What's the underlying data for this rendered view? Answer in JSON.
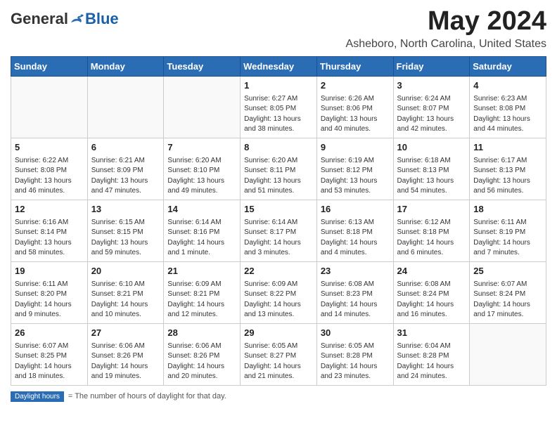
{
  "header": {
    "logo_general": "General",
    "logo_blue": "Blue",
    "month_title": "May 2024",
    "location": "Asheboro, North Carolina, United States"
  },
  "days_of_week": [
    "Sunday",
    "Monday",
    "Tuesday",
    "Wednesday",
    "Thursday",
    "Friday",
    "Saturday"
  ],
  "weeks": [
    [
      {
        "day": "",
        "info": ""
      },
      {
        "day": "",
        "info": ""
      },
      {
        "day": "",
        "info": ""
      },
      {
        "day": "1",
        "info": "Sunrise: 6:27 AM\nSunset: 8:05 PM\nDaylight: 13 hours\nand 38 minutes."
      },
      {
        "day": "2",
        "info": "Sunrise: 6:26 AM\nSunset: 8:06 PM\nDaylight: 13 hours\nand 40 minutes."
      },
      {
        "day": "3",
        "info": "Sunrise: 6:24 AM\nSunset: 8:07 PM\nDaylight: 13 hours\nand 42 minutes."
      },
      {
        "day": "4",
        "info": "Sunrise: 6:23 AM\nSunset: 8:08 PM\nDaylight: 13 hours\nand 44 minutes."
      }
    ],
    [
      {
        "day": "5",
        "info": "Sunrise: 6:22 AM\nSunset: 8:08 PM\nDaylight: 13 hours\nand 46 minutes."
      },
      {
        "day": "6",
        "info": "Sunrise: 6:21 AM\nSunset: 8:09 PM\nDaylight: 13 hours\nand 47 minutes."
      },
      {
        "day": "7",
        "info": "Sunrise: 6:20 AM\nSunset: 8:10 PM\nDaylight: 13 hours\nand 49 minutes."
      },
      {
        "day": "8",
        "info": "Sunrise: 6:20 AM\nSunset: 8:11 PM\nDaylight: 13 hours\nand 51 minutes."
      },
      {
        "day": "9",
        "info": "Sunrise: 6:19 AM\nSunset: 8:12 PM\nDaylight: 13 hours\nand 53 minutes."
      },
      {
        "day": "10",
        "info": "Sunrise: 6:18 AM\nSunset: 8:13 PM\nDaylight: 13 hours\nand 54 minutes."
      },
      {
        "day": "11",
        "info": "Sunrise: 6:17 AM\nSunset: 8:13 PM\nDaylight: 13 hours\nand 56 minutes."
      }
    ],
    [
      {
        "day": "12",
        "info": "Sunrise: 6:16 AM\nSunset: 8:14 PM\nDaylight: 13 hours\nand 58 minutes."
      },
      {
        "day": "13",
        "info": "Sunrise: 6:15 AM\nSunset: 8:15 PM\nDaylight: 13 hours\nand 59 minutes."
      },
      {
        "day": "14",
        "info": "Sunrise: 6:14 AM\nSunset: 8:16 PM\nDaylight: 14 hours\nand 1 minute."
      },
      {
        "day": "15",
        "info": "Sunrise: 6:14 AM\nSunset: 8:17 PM\nDaylight: 14 hours\nand 3 minutes."
      },
      {
        "day": "16",
        "info": "Sunrise: 6:13 AM\nSunset: 8:18 PM\nDaylight: 14 hours\nand 4 minutes."
      },
      {
        "day": "17",
        "info": "Sunrise: 6:12 AM\nSunset: 8:18 PM\nDaylight: 14 hours\nand 6 minutes."
      },
      {
        "day": "18",
        "info": "Sunrise: 6:11 AM\nSunset: 8:19 PM\nDaylight: 14 hours\nand 7 minutes."
      }
    ],
    [
      {
        "day": "19",
        "info": "Sunrise: 6:11 AM\nSunset: 8:20 PM\nDaylight: 14 hours\nand 9 minutes."
      },
      {
        "day": "20",
        "info": "Sunrise: 6:10 AM\nSunset: 8:21 PM\nDaylight: 14 hours\nand 10 minutes."
      },
      {
        "day": "21",
        "info": "Sunrise: 6:09 AM\nSunset: 8:21 PM\nDaylight: 14 hours\nand 12 minutes."
      },
      {
        "day": "22",
        "info": "Sunrise: 6:09 AM\nSunset: 8:22 PM\nDaylight: 14 hours\nand 13 minutes."
      },
      {
        "day": "23",
        "info": "Sunrise: 6:08 AM\nSunset: 8:23 PM\nDaylight: 14 hours\nand 14 minutes."
      },
      {
        "day": "24",
        "info": "Sunrise: 6:08 AM\nSunset: 8:24 PM\nDaylight: 14 hours\nand 16 minutes."
      },
      {
        "day": "25",
        "info": "Sunrise: 6:07 AM\nSunset: 8:24 PM\nDaylight: 14 hours\nand 17 minutes."
      }
    ],
    [
      {
        "day": "26",
        "info": "Sunrise: 6:07 AM\nSunset: 8:25 PM\nDaylight: 14 hours\nand 18 minutes."
      },
      {
        "day": "27",
        "info": "Sunrise: 6:06 AM\nSunset: 8:26 PM\nDaylight: 14 hours\nand 19 minutes."
      },
      {
        "day": "28",
        "info": "Sunrise: 6:06 AM\nSunset: 8:26 PM\nDaylight: 14 hours\nand 20 minutes."
      },
      {
        "day": "29",
        "info": "Sunrise: 6:05 AM\nSunset: 8:27 PM\nDaylight: 14 hours\nand 21 minutes."
      },
      {
        "day": "30",
        "info": "Sunrise: 6:05 AM\nSunset: 8:28 PM\nDaylight: 14 hours\nand 23 minutes."
      },
      {
        "day": "31",
        "info": "Sunrise: 6:04 AM\nSunset: 8:28 PM\nDaylight: 14 hours\nand 24 minutes."
      },
      {
        "day": "",
        "info": ""
      }
    ]
  ],
  "footer": {
    "label": "Daylight hours"
  }
}
